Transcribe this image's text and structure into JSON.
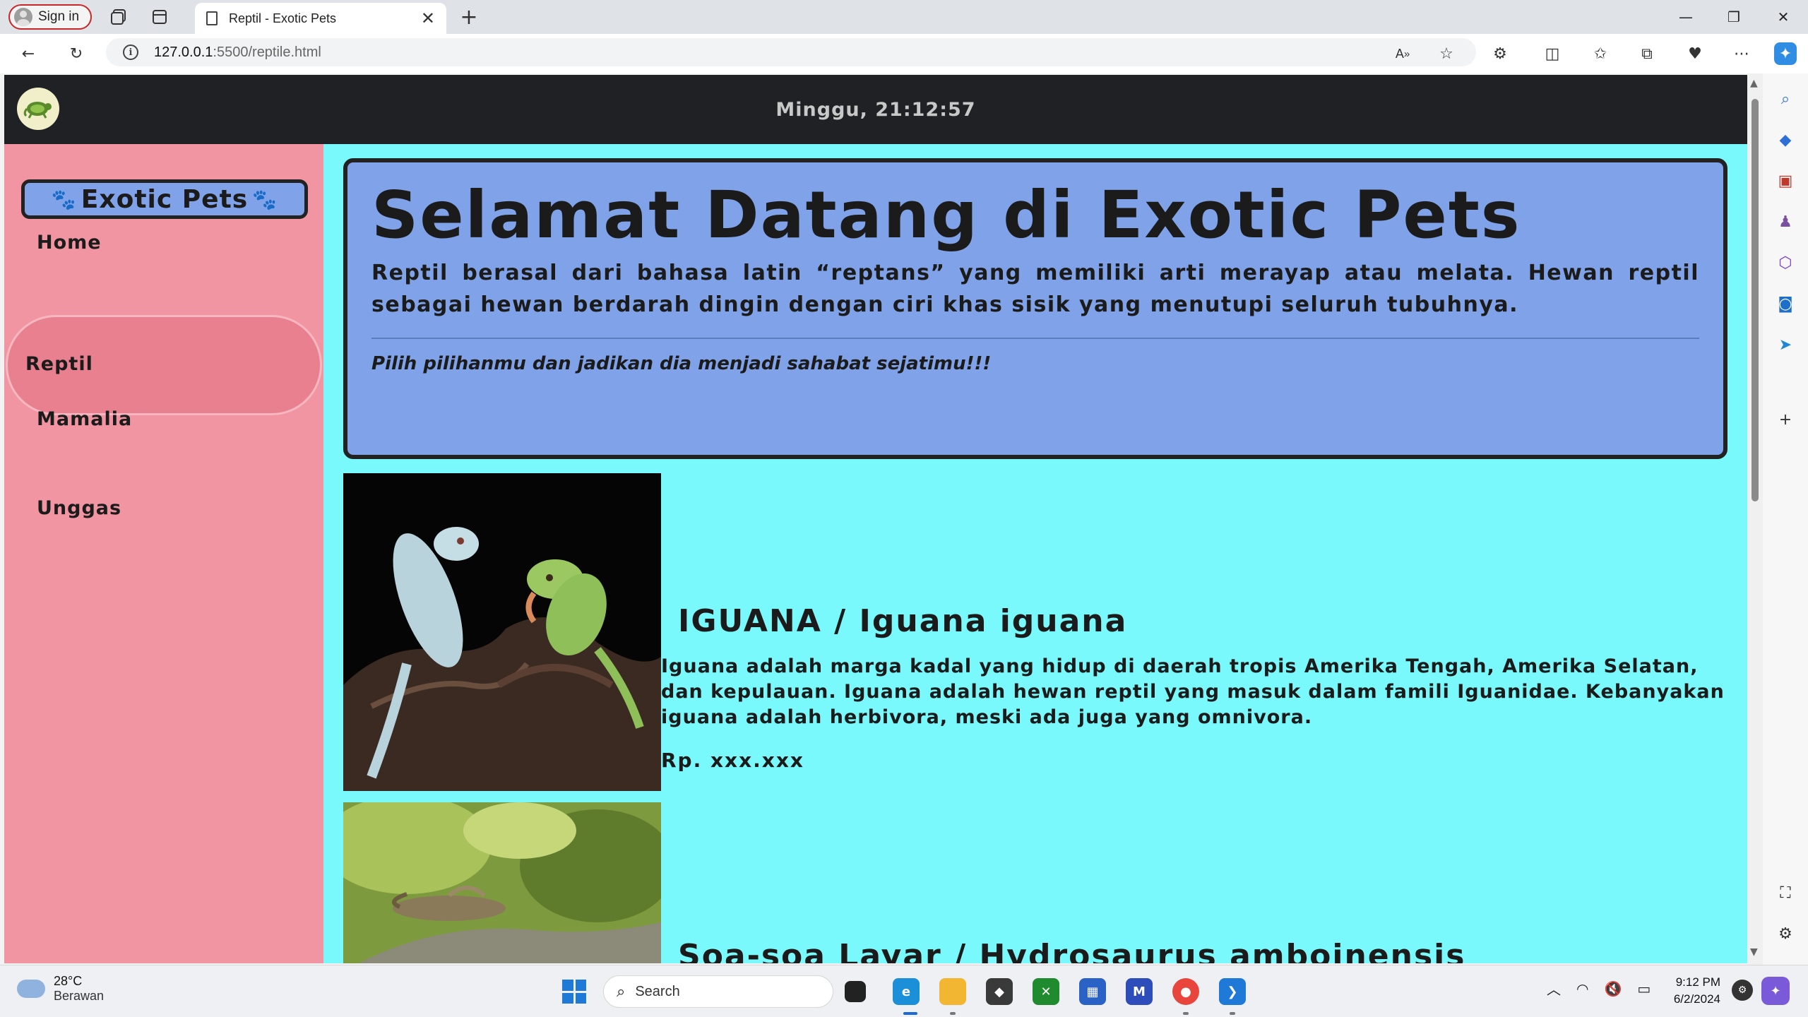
{
  "browser": {
    "signin_label": "Sign in",
    "tab_title": "Reptil - Exotic Pets",
    "url_host": "127.0.0.1",
    "url_path": ":5500/reptile.html"
  },
  "site": {
    "clock_text": "Minggu, 21:12:57",
    "brand": "Exotic Pets",
    "nav": [
      {
        "label": "Home",
        "active": false
      },
      {
        "label": "Reptil",
        "active": true
      },
      {
        "label": "Mamalia",
        "active": false
      },
      {
        "label": "Unggas",
        "active": false
      }
    ],
    "welcome": {
      "heading": "Selamat Datang di Exotic Pets",
      "intro": "Reptil berasal dari bahasa latin “reptans” yang memiliki arti merayap atau melata. Hewan reptil sebagai hewan berdarah dingin dengan ciri khas sisik yang menutupi seluruh tubuhnya.",
      "tagline": "Pilih pilihanmu dan jadikan dia menjadi sahabat sejatimu!!!"
    },
    "animals": [
      {
        "name": "IGUANA / Iguana iguana",
        "description": "Iguana adalah marga kadal yang hidup di daerah tropis Amerika Tengah, Amerika Selatan, dan kepulauan. Iguana adalah hewan reptil yang masuk dalam famili Iguanidae. Kebanyakan iguana adalah herbivora, meski ada juga yang omnivora.",
        "price": "Rp. xxx.xxx"
      },
      {
        "name": "Soa-soa Layar / Hydrosaurus amboinensis"
      }
    ]
  },
  "taskbar": {
    "weather_temp": "28°C",
    "weather_cond": "Berawan",
    "search_label": "Search",
    "time": "9:12 PM",
    "date": "6/2/2024"
  },
  "colors": {
    "page_bg": "#79f9fb",
    "sidebar_bg": "#f295a2",
    "active_nav": "#e8808f",
    "card_bg": "#7fa2e8",
    "header_bg": "#1f2124"
  }
}
